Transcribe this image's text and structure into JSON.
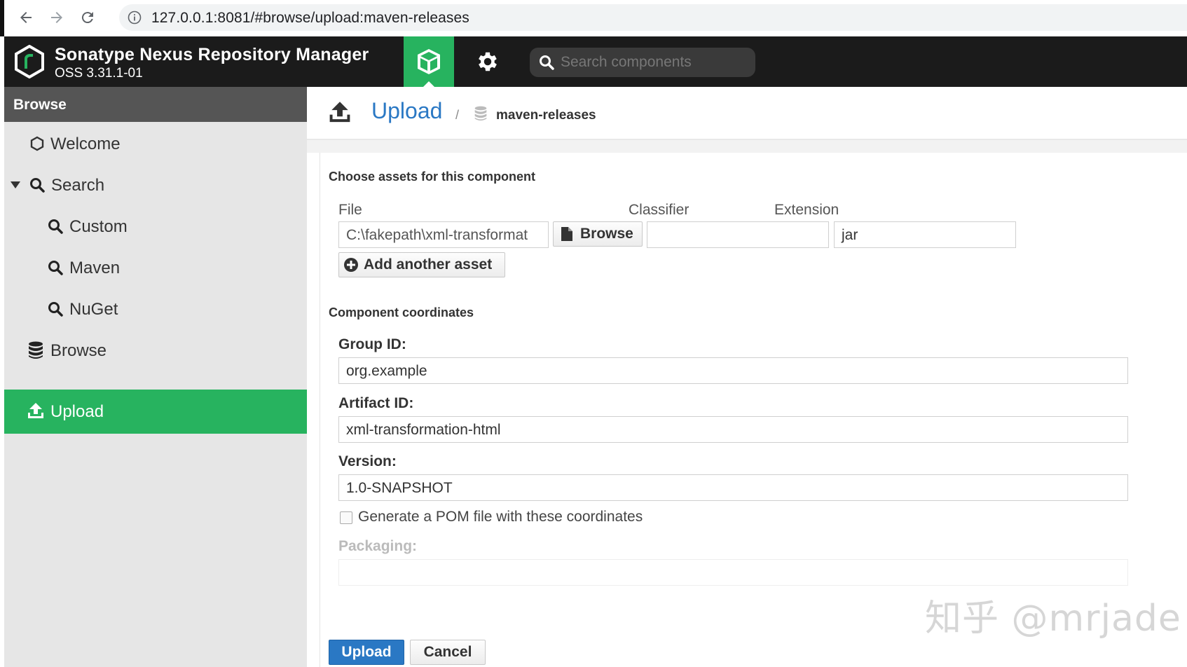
{
  "browser": {
    "url": "127.0.0.1:8081/#browse/upload:maven-releases"
  },
  "header": {
    "title": "Sonatype Nexus Repository Manager",
    "version": "OSS 3.31.1-01",
    "search_placeholder": "Search components"
  },
  "sidebar": {
    "heading": "Browse",
    "items": [
      {
        "label": "Welcome"
      },
      {
        "label": "Search"
      },
      {
        "label": "Custom"
      },
      {
        "label": "Maven"
      },
      {
        "label": "NuGet"
      },
      {
        "label": "Browse"
      },
      {
        "label": "Upload"
      }
    ]
  },
  "page": {
    "title": "Upload",
    "separator": "/",
    "repository": "maven-releases"
  },
  "assets": {
    "section_title": "Choose assets for this component",
    "file_label": "File",
    "classifier_label": "Classifier",
    "extension_label": "Extension",
    "file_value": "C:\\fakepath\\xml-transformat",
    "browse_label": "Browse",
    "classifier_value": "",
    "extension_value": "jar",
    "add_asset_label": "Add another asset"
  },
  "coordinates": {
    "section_title": "Component coordinates",
    "group_label": "Group ID:",
    "group_value": "org.example",
    "artifact_label": "Artifact ID:",
    "artifact_value": "xml-transformation-html",
    "version_label": "Version:",
    "version_value": "1.0-SNAPSHOT",
    "pom_label": "Generate a POM file with these coordinates",
    "packaging_label": "Packaging:",
    "packaging_value": ""
  },
  "actions": {
    "upload_label": "Upload",
    "cancel_label": "Cancel"
  },
  "watermark": "知乎 @mrjade",
  "colors": {
    "accent_green": "#27b35f",
    "link_blue": "#2a78c4",
    "header_dark": "#1b1b1b"
  }
}
